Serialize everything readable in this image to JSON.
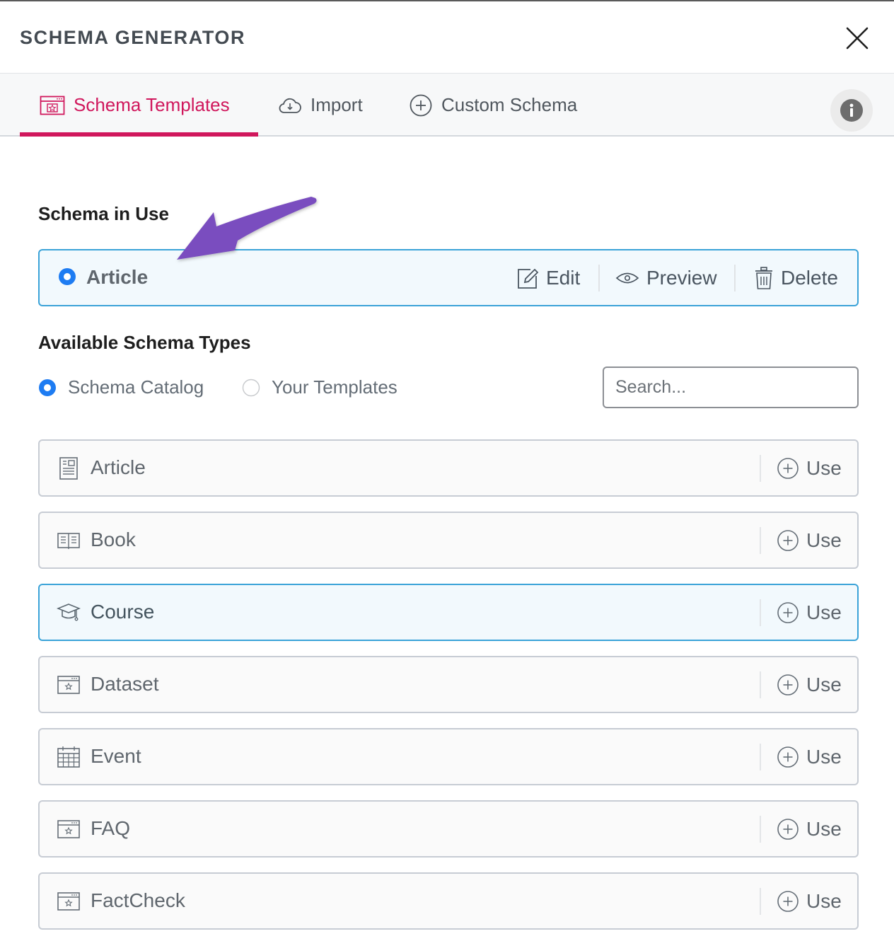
{
  "header": {
    "title": "SCHEMA GENERATOR",
    "close_icon": "close-icon"
  },
  "tabs": [
    {
      "label": "Schema Templates",
      "icon": "template-icon",
      "active": true
    },
    {
      "label": "Import",
      "icon": "cloud-download-icon",
      "active": false
    },
    {
      "label": "Custom Schema",
      "icon": "plus-circle-icon",
      "active": false
    }
  ],
  "info_icon": "info-icon",
  "colors": {
    "accent": "#d0175c",
    "highlight_border": "#3ba3d8",
    "highlight_bg": "#f2f9fd",
    "radio_blue": "#1e7cf2",
    "annotation_arrow": "#7a4dbf"
  },
  "schema_in_use": {
    "heading": "Schema in Use",
    "item": "Article",
    "actions": [
      {
        "label": "Edit",
        "icon": "edit-icon"
      },
      {
        "label": "Preview",
        "icon": "eye-icon"
      },
      {
        "label": "Delete",
        "icon": "trash-icon"
      }
    ]
  },
  "available": {
    "heading": "Available Schema Types",
    "filters": [
      {
        "label": "Schema Catalog",
        "selected": true
      },
      {
        "label": "Your Templates",
        "selected": false
      }
    ],
    "search_placeholder": "Search...",
    "use_label": "Use",
    "items": [
      {
        "label": "Article",
        "icon": "article-icon",
        "highlighted": false
      },
      {
        "label": "Book",
        "icon": "book-icon",
        "highlighted": false
      },
      {
        "label": "Course",
        "icon": "graduation-cap-icon",
        "highlighted": true
      },
      {
        "label": "Dataset",
        "icon": "template-icon",
        "highlighted": false
      },
      {
        "label": "Event",
        "icon": "calendar-icon",
        "highlighted": false
      },
      {
        "label": "FAQ",
        "icon": "template-icon",
        "highlighted": false
      },
      {
        "label": "FactCheck",
        "icon": "template-icon",
        "highlighted": false
      }
    ]
  }
}
